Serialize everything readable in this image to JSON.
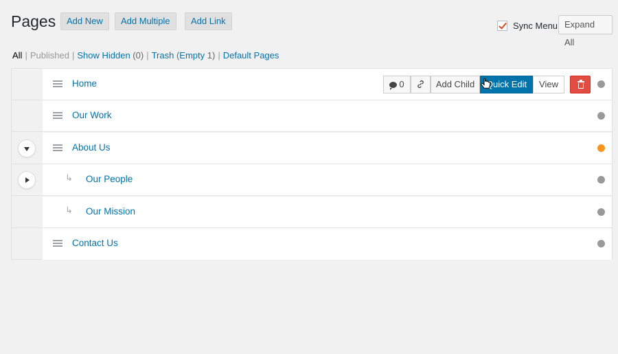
{
  "header": {
    "title": "Pages",
    "add_new": "Add New",
    "add_multiple": "Add Multiple",
    "add_link": "Add Link",
    "sync_menu_label": "Sync Menu",
    "sync_menu_checked": true,
    "expand_all": "Expand All"
  },
  "filters": {
    "all": "All",
    "published": "Published",
    "show_hidden": "Show Hidden",
    "show_hidden_count": "(0)",
    "trash": "Trash",
    "trash_empty": "(",
    "empty_label": "Empty",
    "trash_count": "1)",
    "default_pages": "Default Pages"
  },
  "rows": [
    {
      "title": "Home",
      "indent": 0,
      "status_color": "#999999",
      "has_toggle": false,
      "hover": true
    },
    {
      "title": "Our Work",
      "indent": 0,
      "status_color": "#999999",
      "has_toggle": false
    },
    {
      "title": "About Us",
      "indent": 0,
      "status_color": "#f7941d",
      "has_toggle": true,
      "toggle": "expanded"
    },
    {
      "title": "Our People",
      "indent": 1,
      "status_color": "#999999",
      "has_toggle": true,
      "toggle": "collapsed"
    },
    {
      "title": "Our Mission",
      "indent": 1,
      "status_color": "#999999",
      "has_toggle": false
    },
    {
      "title": "Contact Us",
      "indent": 0,
      "status_color": "#999999",
      "has_toggle": false
    }
  ],
  "row_actions": {
    "comment_count": "0",
    "add_child": "Add Child",
    "quick_edit": "Quick Edit",
    "view": "View"
  },
  "colors": {
    "link": "#0073aa",
    "primary": "#0073aa",
    "danger": "#e14d43",
    "status_orange": "#f7941d",
    "status_gray": "#999999"
  }
}
